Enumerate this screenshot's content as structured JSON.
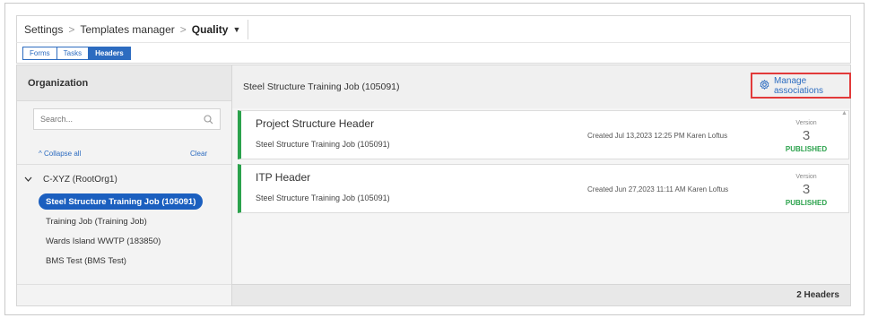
{
  "breadcrumb": {
    "items": [
      "Settings",
      "Templates manager"
    ],
    "current": "Quality"
  },
  "tabs": [
    {
      "label": "Forms",
      "active": false
    },
    {
      "label": "Tasks",
      "active": false
    },
    {
      "label": "Headers",
      "active": true
    }
  ],
  "sidebar": {
    "title": "Organization",
    "search_placeholder": "Search...",
    "collapse_label": "^ Collapse all",
    "clear_label": "Clear",
    "root": "C-XYZ (RootOrg1)",
    "nodes": [
      {
        "label": "Steel Structure Training Job (105091)",
        "selected": true
      },
      {
        "label": "Training Job (Training Job)",
        "selected": false
      },
      {
        "label": "Wards Island WWTP (183850)",
        "selected": false
      },
      {
        "label": "BMS Test (BMS Test)",
        "selected": false
      }
    ]
  },
  "content": {
    "title": "Steel Structure Training Job (105091)",
    "manage_label": "Manage associations",
    "cards": [
      {
        "title": "Project Structure Header",
        "job": "Steel Structure Training Job (105091)",
        "meta": "Created Jul 13,2023 12:25 PM Karen Loftus",
        "version_label": "Version",
        "version": "3",
        "status": "PUBLISHED"
      },
      {
        "title": "ITP Header",
        "job": "Steel Structure Training Job (105091)",
        "meta": "Created Jun 27,2023 11:11 AM Karen Loftus",
        "version_label": "Version",
        "version": "3",
        "status": "PUBLISHED"
      }
    ],
    "footer_count": "2 Headers"
  },
  "colors": {
    "accent": "#2d6cc0",
    "selected": "#1b5fbf",
    "published": "#2ba24c",
    "highlight_box": "#e23a3a"
  }
}
